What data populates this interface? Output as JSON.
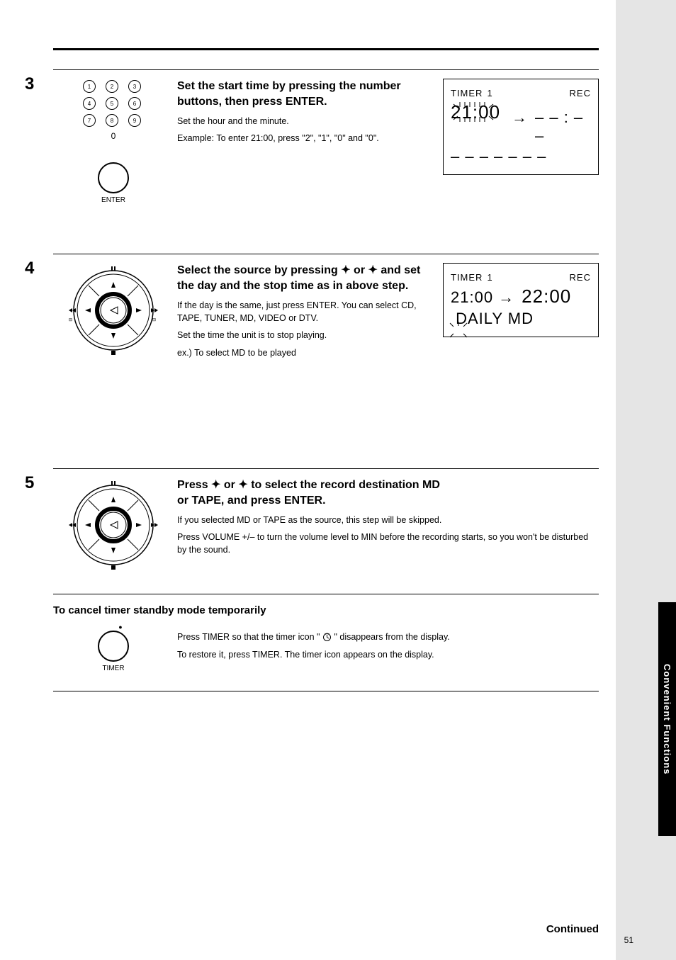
{
  "page_number": "51",
  "side_tab": "Convenient Functions",
  "continued": "Continued",
  "sections": [
    {
      "step": "3",
      "headline": "Set the start time by pressing the number buttons, then press ENTER.",
      "paragraphs": [
        "Set the hour and the minute.",
        "Example:  To enter 21:00, press \"2\", \"1\", \"0\" and \"0\"."
      ],
      "button_label": "ENTER",
      "display": {
        "line1_label": "TIMER",
        "line1_value": "1",
        "line1_mode": "REC",
        "line2_big": "21:00",
        "line2_arrow": "→",
        "line2_dashes": "– – : – –",
        "line3": "– – – –    – – –"
      }
    },
    {
      "step": "4",
      "headline_lines": [
        "Select the source by pressing ✦ or ✦ and set",
        "the day and the stop time as in above step."
      ],
      "paragraphs": [
        "If the day is the same, just press ENTER. You can select CD, TAPE, TUNER, MD, VIDEO or DTV.",
        "Set the time the unit is to stop playing.",
        "ex.) To select MD to be played"
      ],
      "display": {
        "line1_label": "TIMER",
        "line1_value": "1",
        "line1_mode": "REC",
        "line2_pre": "21:00  →",
        "line2_big": "22:00",
        "line3": "DAILY    MD"
      }
    },
    {
      "step": "5",
      "headline_lines": [
        "Press ✦ or ✦ to select the record destination MD",
        "or TAPE, and press ENTER."
      ],
      "paragraphs": [
        "If you selected MD or TAPE as the source, this step will be skipped.",
        "Press VOLUME +/– to turn the volume level to MIN before the recording starts, so you won't be disturbed by the sound."
      ]
    }
  ],
  "cancel": {
    "heading": "To cancel timer standby mode temporarily",
    "timer_label": "TIMER",
    "p1_prefix": "Press TIMER so that the timer icon \"",
    "p1_suffix": "\" disappears from the display.",
    "p2": "To restore it, press TIMER. The timer icon appears on the display."
  }
}
